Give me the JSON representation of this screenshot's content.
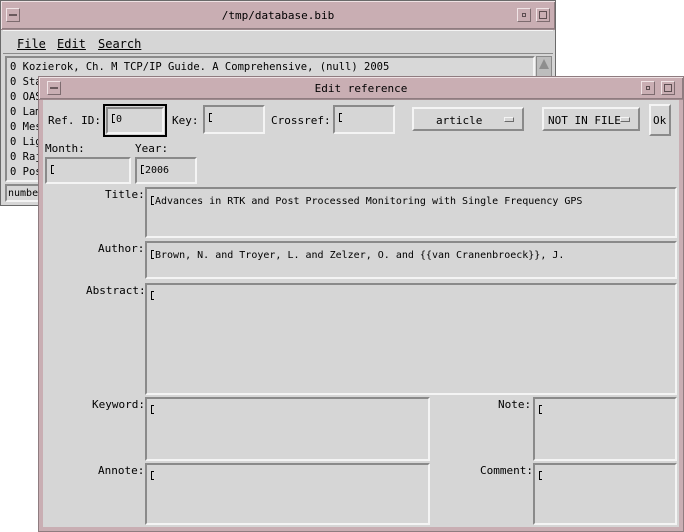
{
  "main_window": {
    "title": "/tmp/database.bib",
    "menu": [
      "File",
      "Edit",
      "Search"
    ],
    "entries": [
      "0 Kozierok, Ch. M TCP/IP Guide. A Comprehensive, (null) 2005",
      "0 Sta",
      "0 OAS",
      "0 Lam",
      "0 Mes",
      "0 Lig",
      "0 Raj",
      "0 Pos"
    ],
    "status_text": "number"
  },
  "dialog": {
    "title": "Edit reference",
    "ref_id_label": "Ref. ID:",
    "ref_id_value": "0",
    "key_label": "Key:",
    "key_value": "",
    "crossref_label": "Crossref:",
    "crossref_value": "",
    "type_option": "article",
    "file_option": "NOT IN FILE",
    "ok_label": "Ok",
    "month_label": "Month:",
    "month_value": "",
    "year_label": "Year:",
    "year_value": "2006",
    "title_label": "Title:",
    "title_value": "Advances in RTK and Post Processed Monitoring with Single Frequency GPS",
    "author_label": "Author:",
    "author_value": "Brown, N. and Troyer, L. and Zelzer, O. and  {{van Cranenbroeck}}, J.",
    "abstract_label": "Abstract:",
    "abstract_value": "",
    "keyword_label": "Keyword:",
    "keyword_value": "",
    "note_label": "Note:",
    "note_value": "",
    "annote_label": "Annote:",
    "annote_value": "",
    "comment_label": "Comment:",
    "comment_value": ""
  }
}
